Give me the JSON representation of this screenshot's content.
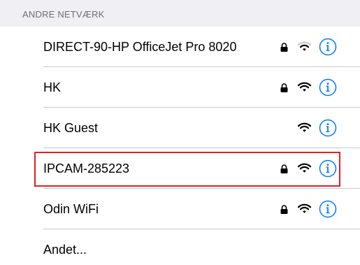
{
  "section_header": "ANDRE NETVÆRK",
  "networks": [
    {
      "name": "DIRECT-90-HP OfficeJet Pro 8020",
      "locked": true,
      "signal": "weak",
      "info_icon": "info-icon"
    },
    {
      "name": "HK",
      "locked": true,
      "signal": "strong",
      "info_icon": "info-icon"
    },
    {
      "name": "HK Guest",
      "locked": false,
      "signal": "strong",
      "info_icon": "info-icon"
    },
    {
      "name": "IPCAM-285223",
      "locked": true,
      "signal": "strong",
      "info_icon": "info-icon",
      "highlighted": true
    },
    {
      "name": "Odin WiFi",
      "locked": true,
      "signal": "strong",
      "info_icon": "info-icon"
    }
  ],
  "other_label": "Andet...",
  "colors": {
    "accent": "#007aff",
    "highlight": "#e02020",
    "weak_signal": "#c7c7cc",
    "text": "#000000",
    "header_text": "#6d6d72"
  },
  "icons": {
    "lock": "lock-icon",
    "wifi": "wifi-icon",
    "info": "info-icon"
  }
}
